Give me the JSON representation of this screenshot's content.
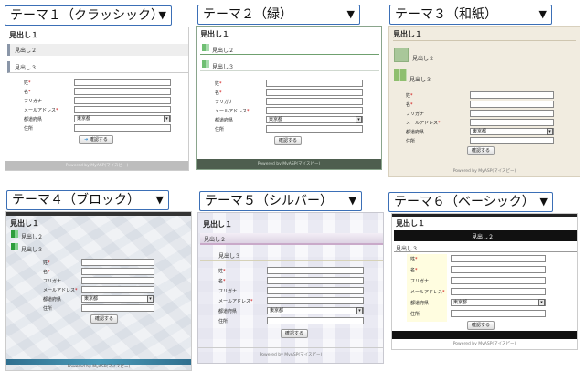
{
  "themes": [
    {
      "name": "テーマ１（クラッシック）"
    },
    {
      "name": "テーマ２（緑）"
    },
    {
      "name": "テーマ３（和紙）"
    },
    {
      "name": "テーマ４（ブロック）"
    },
    {
      "name": "テーマ５（シルバー）"
    },
    {
      "name": "テーマ６（ベーシック）"
    }
  ],
  "dropdown_arrow": "▼",
  "preview": {
    "h1": "見出し１",
    "h2": "見出し２",
    "h3": "見出し３",
    "fields": {
      "sei": "姓",
      "mei": "名",
      "furigana": "フリガナ",
      "email": "メールアドレス",
      "pref": "都道府県",
      "address": "住所"
    },
    "required_mark": "*",
    "pref_value": "東京都",
    "confirm_button": "確認する",
    "confirm_arrow": "➜",
    "footer": "Powered by MyASP(マイスピー)"
  },
  "colors": {
    "select_border": "#3b6fb6",
    "classic_footer": "#bdbdbd",
    "green_footer": "#4e5e4f",
    "washi_bg": "#f1ece0",
    "basic_header": "#111111",
    "required": "#cc0000"
  }
}
